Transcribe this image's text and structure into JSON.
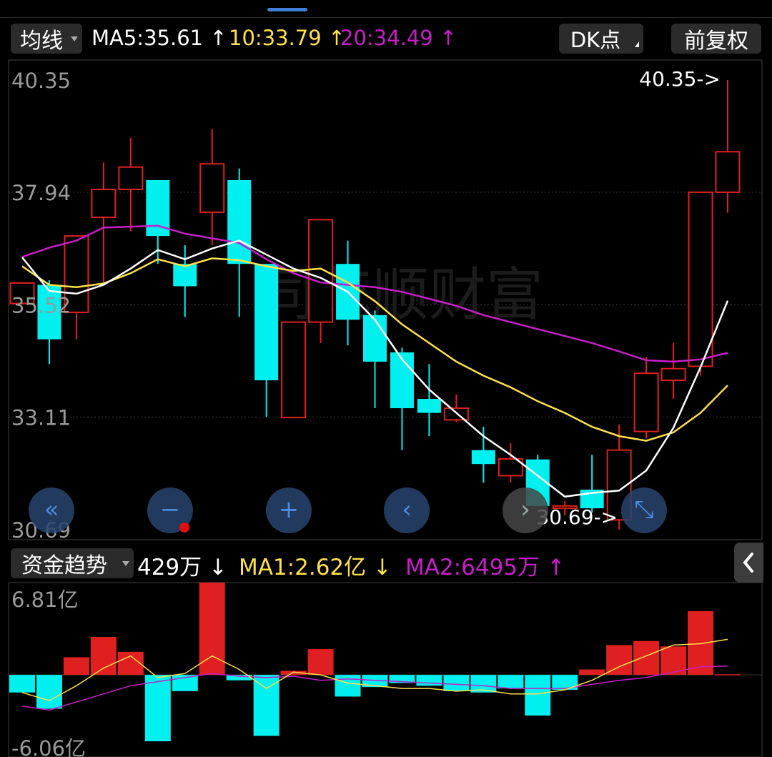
{
  "header": {
    "indicator_label": "均线",
    "ma5": "MA5:35.61",
    "ma10": "10:33.79",
    "ma20": "20:34.49",
    "up_arrow": "↑",
    "dk_label": "DK点",
    "adjust_label": "前复权"
  },
  "watermark": "同花顺财富",
  "sub_header": {
    "indicator_label": "资金趋势",
    "value": "429万",
    "ma1": "MA1:2.62亿",
    "ma2": "MA2:6495万",
    "down_arrow": "↓",
    "up_arrow": "↑"
  },
  "colors": {
    "up": "#e02020",
    "down": "#00f0f0",
    "ma5": "#ffffff",
    "ma10": "#ffe14a",
    "ma20": "#c81ec8",
    "grid": "#2c2c2c"
  },
  "controls": [
    {
      "name": "scroll-left-icon",
      "glyph": "«"
    },
    {
      "name": "zoom-out-icon",
      "glyph": "−"
    },
    {
      "name": "zoom-in-icon",
      "glyph": "+"
    },
    {
      "name": "prev-icon",
      "glyph": "‹"
    },
    {
      "name": "next-icon",
      "glyph": "›"
    },
    {
      "name": "fullscreen-icon",
      "glyph": "⤡"
    }
  ],
  "chart_data": [
    {
      "type": "candlestick",
      "y_tick_labels": [
        "40.35",
        "37.94",
        "35.52",
        "33.11",
        "30.69"
      ],
      "ylim": [
        30.69,
        40.35
      ],
      "max_label": "40.35->",
      "min_label": "30.69->",
      "candles": [
        {
          "o": 35.55,
          "c": 35.99,
          "h": 35.99,
          "l": 35.55
        },
        {
          "o": 35.95,
          "c": 34.78,
          "h": 36.05,
          "l": 34.25
        },
        {
          "o": 35.36,
          "c": 37.0,
          "h": 37.0,
          "l": 34.78
        },
        {
          "o": 37.4,
          "c": 38.0,
          "h": 38.58,
          "l": 36.0
        },
        {
          "o": 38.0,
          "c": 38.48,
          "h": 39.11,
          "l": 37.1
        },
        {
          "o": 38.2,
          "c": 37.0,
          "h": 37.98,
          "l": 36.4
        },
        {
          "o": 36.4,
          "c": 35.92,
          "h": 36.8,
          "l": 35.26
        },
        {
          "o": 37.51,
          "c": 38.55,
          "h": 39.3,
          "l": 36.8
        },
        {
          "o": 38.2,
          "c": 36.4,
          "h": 38.45,
          "l": 35.26
        },
        {
          "o": 36.4,
          "c": 33.9,
          "h": 36.4,
          "l": 33.11
        },
        {
          "o": 33.1,
          "c": 35.15,
          "h": 35.15,
          "l": 33.1
        },
        {
          "o": 35.15,
          "c": 37.35,
          "h": 37.35,
          "l": 34.7
        },
        {
          "o": 36.4,
          "c": 35.2,
          "h": 36.9,
          "l": 34.65
        },
        {
          "o": 35.3,
          "c": 34.3,
          "h": 35.4,
          "l": 33.3
        },
        {
          "o": 34.5,
          "c": 33.3,
          "h": 34.6,
          "l": 32.4
        },
        {
          "o": 33.5,
          "c": 33.2,
          "h": 34.25,
          "l": 32.7
        },
        {
          "o": 33.05,
          "c": 33.3,
          "h": 33.6,
          "l": 33.0
        },
        {
          "o": 32.4,
          "c": 32.1,
          "h": 32.9,
          "l": 31.7
        },
        {
          "o": 31.85,
          "c": 32.21,
          "h": 32.55,
          "l": 31.7
        },
        {
          "o": 32.2,
          "c": 31.2,
          "h": 32.3,
          "l": 31.2
        },
        {
          "o": 31.15,
          "c": 31.2,
          "h": 31.3,
          "l": 31.0
        },
        {
          "o": 31.55,
          "c": 31.15,
          "h": 32.3,
          "l": 31.05
        },
        {
          "o": 30.9,
          "c": 32.4,
          "h": 32.95,
          "l": 30.69
        },
        {
          "o": 32.8,
          "c": 34.05,
          "h": 34.4,
          "l": 32.65
        },
        {
          "o": 33.9,
          "c": 34.15,
          "h": 34.7,
          "l": 33.5
        },
        {
          "o": 34.2,
          "c": 37.94,
          "h": 37.94,
          "l": 34.0
        },
        {
          "o": 37.94,
          "c": 38.81,
          "h": 40.35,
          "l": 37.5
        }
      ],
      "ma5": [
        36.54,
        35.82,
        35.76,
        35.95,
        36.3,
        36.7,
        36.5,
        36.73,
        36.9,
        36.6,
        36.3,
        36.1,
        35.8,
        35.2,
        34.35,
        33.7,
        33.2,
        32.7,
        32.3,
        31.85,
        31.4,
        31.48,
        31.53,
        31.96,
        32.88,
        34.18,
        35.61
      ],
      "ma10": [
        36.35,
        35.95,
        35.9,
        35.98,
        36.2,
        36.5,
        36.35,
        36.52,
        36.48,
        36.35,
        36.25,
        36.3,
        36.0,
        35.6,
        35.1,
        34.7,
        34.3,
        34.0,
        33.75,
        33.45,
        33.2,
        32.9,
        32.7,
        32.6,
        32.78,
        33.2,
        33.79
      ],
      "ma20": [
        36.55,
        36.75,
        36.9,
        37.18,
        37.2,
        37.22,
        37.05,
        36.95,
        36.85,
        36.5,
        36.2,
        36.0,
        35.95,
        35.9,
        35.8,
        35.65,
        35.5,
        35.3,
        35.15,
        35.0,
        34.85,
        34.7,
        34.52,
        34.33,
        34.3,
        34.35,
        34.49
      ]
    },
    {
      "type": "bar",
      "y_tick_labels": [
        "6.81亿",
        "-6.06亿"
      ],
      "unit": "亿",
      "ylim": [
        -6.06,
        6.81
      ],
      "values": [
        -1.3,
        -2.5,
        1.3,
        2.8,
        1.7,
        -4.9,
        -1.2,
        6.81,
        -0.4,
        -4.5,
        0.3,
        1.9,
        -1.6,
        -0.9,
        -0.6,
        -0.8,
        -1.2,
        -1.3,
        -1.0,
        -3.0,
        -1.1,
        0.4,
        2.2,
        2.5,
        2.1,
        4.7,
        0.0429
      ],
      "ma1": [
        -1.3,
        -1.9,
        -0.8,
        0.5,
        1.4,
        -0.2,
        0.1,
        1.4,
        0.4,
        -1.0,
        0.2,
        0.0,
        -0.6,
        -0.8,
        -1.0,
        -1.0,
        -1.2,
        -1.1,
        -1.4,
        -1.4,
        -1.1,
        -0.4,
        0.6,
        1.4,
        2.2,
        2.3,
        2.62
      ],
      "ma2": [
        -2.3,
        -2.6,
        -2.0,
        -1.4,
        -0.8,
        -0.5,
        -0.2,
        0.1,
        -0.1,
        -0.2,
        -0.1,
        -0.4,
        -0.3,
        -0.4,
        -0.5,
        -0.6,
        -0.7,
        -0.8,
        -1.0,
        -1.0,
        -1.0,
        -0.7,
        -0.4,
        -0.2,
        0.2,
        0.6,
        0.6495
      ]
    }
  ]
}
